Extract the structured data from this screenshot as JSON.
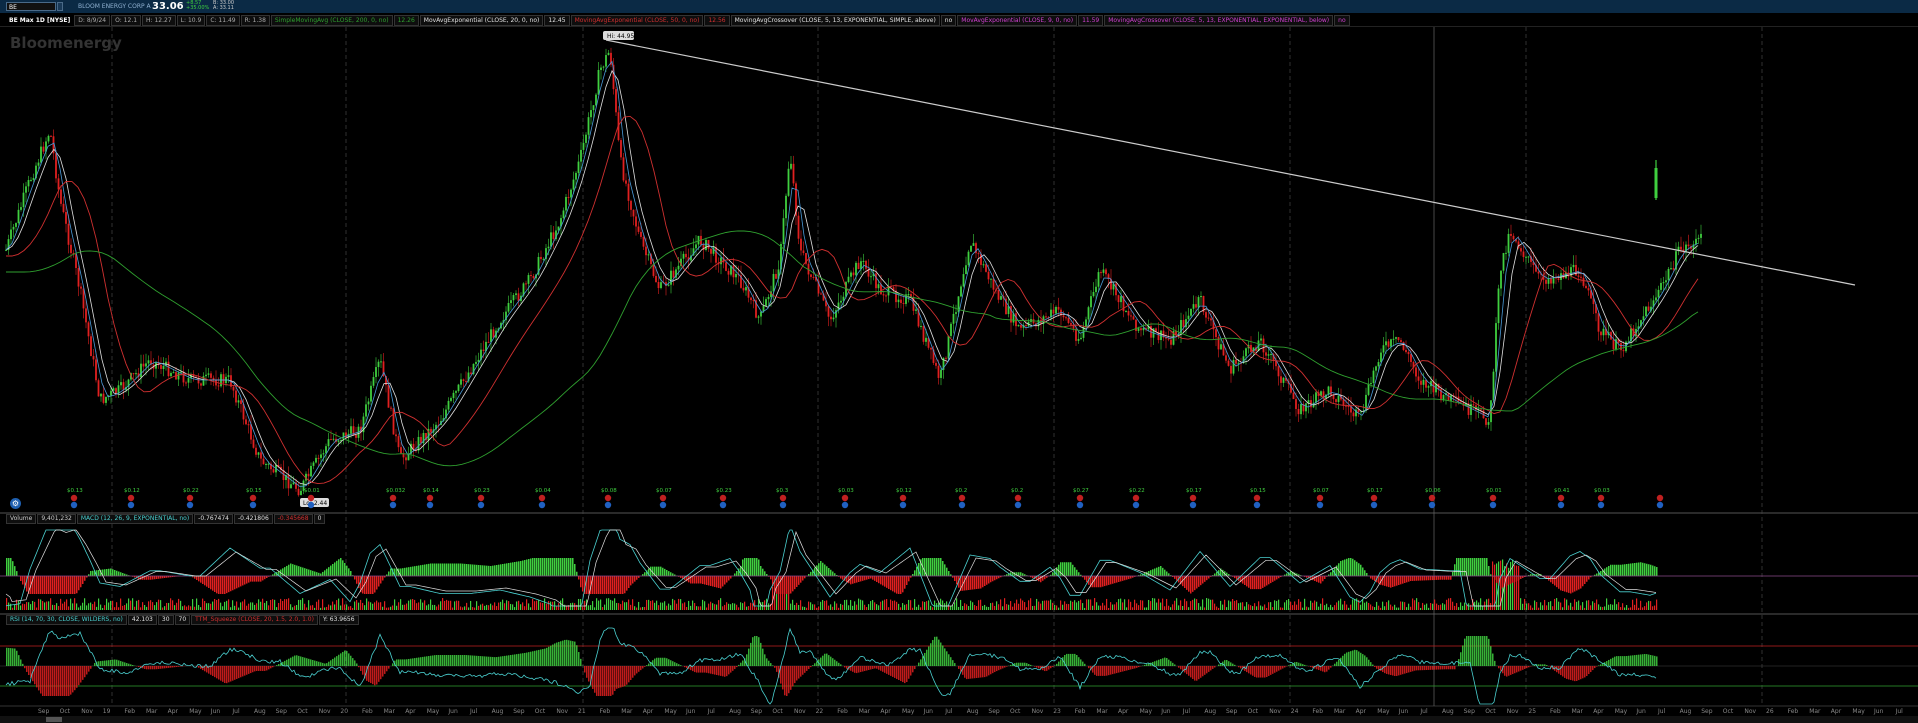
{
  "header": {
    "symbol": "BE",
    "company": "BLOOM ENERGY CORP A",
    "last": "33.06",
    "change": [
      "+8.57",
      "+35.00%"
    ],
    "bidask": [
      "B: 33.00",
      "A: 33.11"
    ]
  },
  "studies": {
    "chart_title": "BE Max 1D [NYSE]",
    "ohlc": [
      "D: 8/9/24",
      "O: 12.1",
      "H: 12.27",
      "L: 10.9",
      "C: 11.49",
      "R: 1.38"
    ],
    "sma": "SimpleMovingAvg (CLOSE, 200, 0, no)",
    "sma_val": "12.26",
    "ema20": "MovAvgExponential (CLOSE, 20, 0, no)",
    "ema20_val": "12.45",
    "ema50": "MovingAvgExponential (CLOSE, 50, 0, no)",
    "ema50_val": "12.56",
    "crossover1": "MovingAvgCrossover (CLOSE, 5, 13, EXPONENTIAL, SIMPLE, above)",
    "crossover1_val": "no",
    "ema9": "MovAvgExponential (CLOSE, 9, 0, no)",
    "ema9_val": "11.59",
    "crossover2": "MovingAvgCrossover (CLOSE, 5, 13, EXPONENTIAL, EXPONENTIAL, below)",
    "crossover2_val": "no"
  },
  "watermark": "Bloomenergy",
  "annotations": {
    "high": "Hi: 44.95",
    "low": "Lo: 2.44"
  },
  "dividends": [
    "$0.13",
    "$0.12",
    "$0.22",
    "$0.15",
    "$0.01",
    "$0.032",
    "$0.14",
    "$0.23",
    "$0.04",
    "$0.08",
    "$0.07",
    "$0.23",
    "$0.3",
    "$0.03",
    "$0.12",
    "$0.2",
    "$0.2",
    "$0.27",
    "$0.22",
    "$0.17",
    "$0.15",
    "$0.07",
    "$0.17",
    "$0.06",
    "$0.01",
    "$0.41",
    "$0.03"
  ],
  "volume_pane": {
    "volume_label": "Volume",
    "volume_val": "9,401,232",
    "macd": "MACD (12, 26, 9, EXPONENTIAL, no)",
    "macd_vals": [
      "-0.767474",
      "-0.421806",
      "-0.345668"
    ],
    "macd_flag": "0"
  },
  "rsi_pane": {
    "rsi": "RSI (14, 70, 30, CLOSE, WILDERS, no)",
    "rsi_vals": [
      "42.103",
      "30",
      "70"
    ],
    "ttm": "TTM_Squeeze (CLOSE, 20, 1.5, 2.0, 1.0)",
    "ttm_val": "Y: 63.9656"
  },
  "time_axis": [
    "Sep",
    "Oct",
    "Nov",
    "19",
    "Feb",
    "Mar",
    "Apr",
    "May",
    "Jun",
    "Jul",
    "Aug",
    "Sep",
    "Oct",
    "Nov",
    "20",
    "Feb",
    "Mar",
    "Apr",
    "May",
    "Jun",
    "Jul",
    "Aug",
    "Sep",
    "Oct",
    "Nov",
    "21",
    "Feb",
    "Mar",
    "Apr",
    "May",
    "Jun",
    "Jul",
    "Aug",
    "Sep",
    "Oct",
    "Nov",
    "22",
    "Feb",
    "Mar",
    "Apr",
    "May",
    "Jun",
    "Jul",
    "Aug",
    "Sep",
    "Oct",
    "Nov",
    "23",
    "Feb",
    "Mar",
    "Apr",
    "May",
    "Jun",
    "Jul",
    "Aug",
    "Sep",
    "Oct",
    "Nov",
    "24",
    "Feb",
    "Mar",
    "Apr",
    "May",
    "Jun",
    "Jul",
    "Aug",
    "Sep",
    "Oct",
    "Nov",
    "25",
    "Feb",
    "Mar",
    "Apr",
    "May",
    "Jun",
    "Jul",
    "Aug",
    "Sep",
    "Oct",
    "Nov",
    "26",
    "Feb",
    "Mar",
    "Apr",
    "May",
    "Jun",
    "Jul"
  ],
  "colors": {
    "up": "#3fcf3f",
    "down": "#e02020",
    "ema_red": "#d03030",
    "sma_green": "#2fa02f",
    "ema_white": "#e0e0e0",
    "ema_blue": "#4a9ad8",
    "trendline": "#cccccc",
    "macd_line": "#4ad0d0"
  }
}
